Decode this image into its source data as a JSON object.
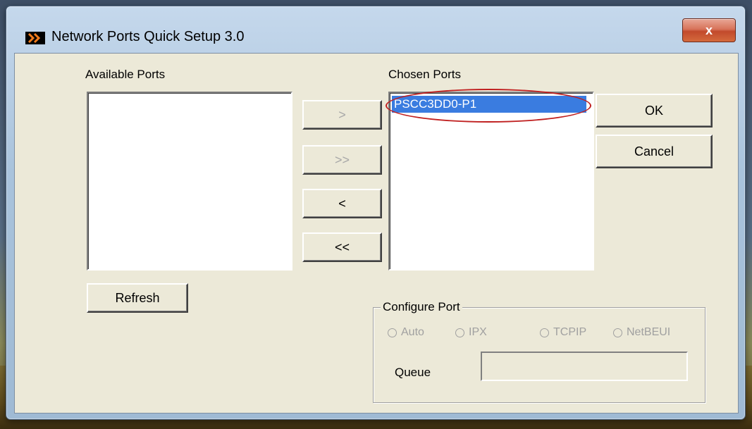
{
  "window": {
    "title": "Network Ports Quick Setup 3.0",
    "close_label": "x"
  },
  "available": {
    "label": "Available Ports",
    "items": []
  },
  "chosen": {
    "label": "Chosen Ports",
    "items": [
      "PSCC3DD0-P1"
    ],
    "selected": "PSCC3DD0-P1"
  },
  "transfer_buttons": {
    "add": ">",
    "add_all": ">>",
    "remove": "<",
    "remove_all": "<<"
  },
  "buttons": {
    "ok": "OK",
    "cancel": "Cancel",
    "refresh": "Refresh"
  },
  "configure_port": {
    "title": "Configure Port",
    "options": [
      "Auto",
      "IPX",
      "TCPIP",
      "NetBEUI"
    ],
    "queue_label": "Queue",
    "queue_value": ""
  },
  "colors": {
    "selection": "#3a7ce0",
    "highlight_ellipse": "#c02020",
    "dialog_bg": "#ece9d8"
  }
}
